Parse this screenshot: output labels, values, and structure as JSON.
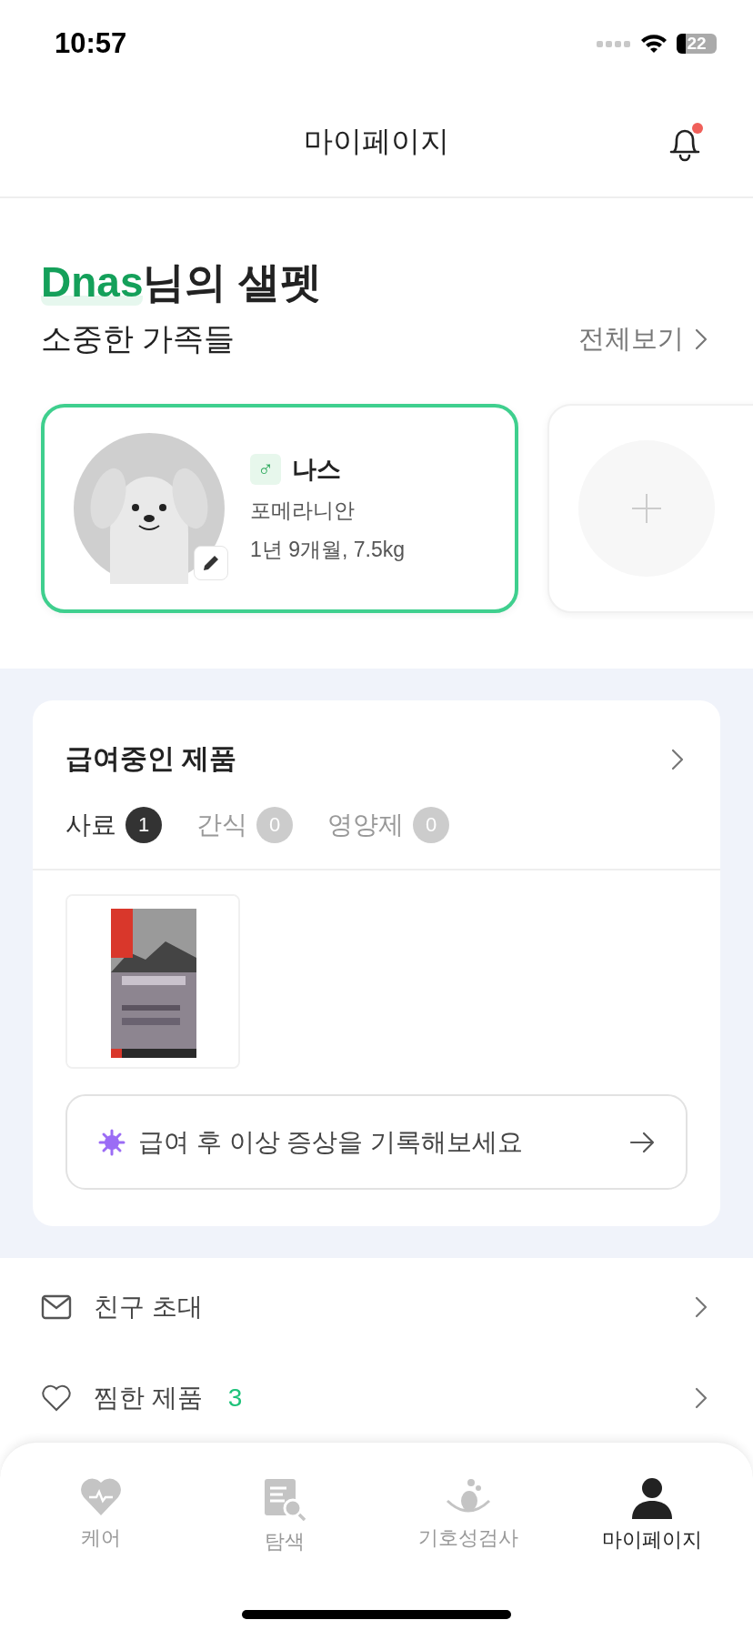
{
  "status_bar": {
    "time": "10:57",
    "battery": "22"
  },
  "header": {
    "title": "마이페이지",
    "notification": true
  },
  "greeting": {
    "name": "Dnas",
    "suffix": "님의 샐펫"
  },
  "family": {
    "title": "소중한 가족들",
    "view_all": "전체보기"
  },
  "pets": [
    {
      "kind": "pet",
      "gender": "♂",
      "name": "나스",
      "breed": "포메라니안",
      "details": "1년 9개월, 7.5kg",
      "selected": true
    },
    {
      "kind": "add",
      "selected": false
    }
  ],
  "feeding": {
    "title": "급여중인 제품",
    "tabs": [
      {
        "label": "사료",
        "count": "1",
        "selected": true
      },
      {
        "label": "간식",
        "count": "0",
        "selected": false
      },
      {
        "label": "영양제",
        "count": "0",
        "selected": false
      }
    ],
    "notice": "급여 후 이상 증상을 기록해보세요"
  },
  "menu": [
    {
      "kind": "mail",
      "label": "친구 초대"
    },
    {
      "kind": "heart",
      "label": "찜한 제품",
      "count": "3"
    }
  ],
  "tab_bar": [
    {
      "kind": "care",
      "label": "케어",
      "selected": false
    },
    {
      "kind": "search",
      "label": "탐색",
      "selected": false
    },
    {
      "kind": "test",
      "label": "기호성검사",
      "selected": false
    },
    {
      "kind": "person",
      "label": "마이페이지",
      "selected": true
    }
  ]
}
